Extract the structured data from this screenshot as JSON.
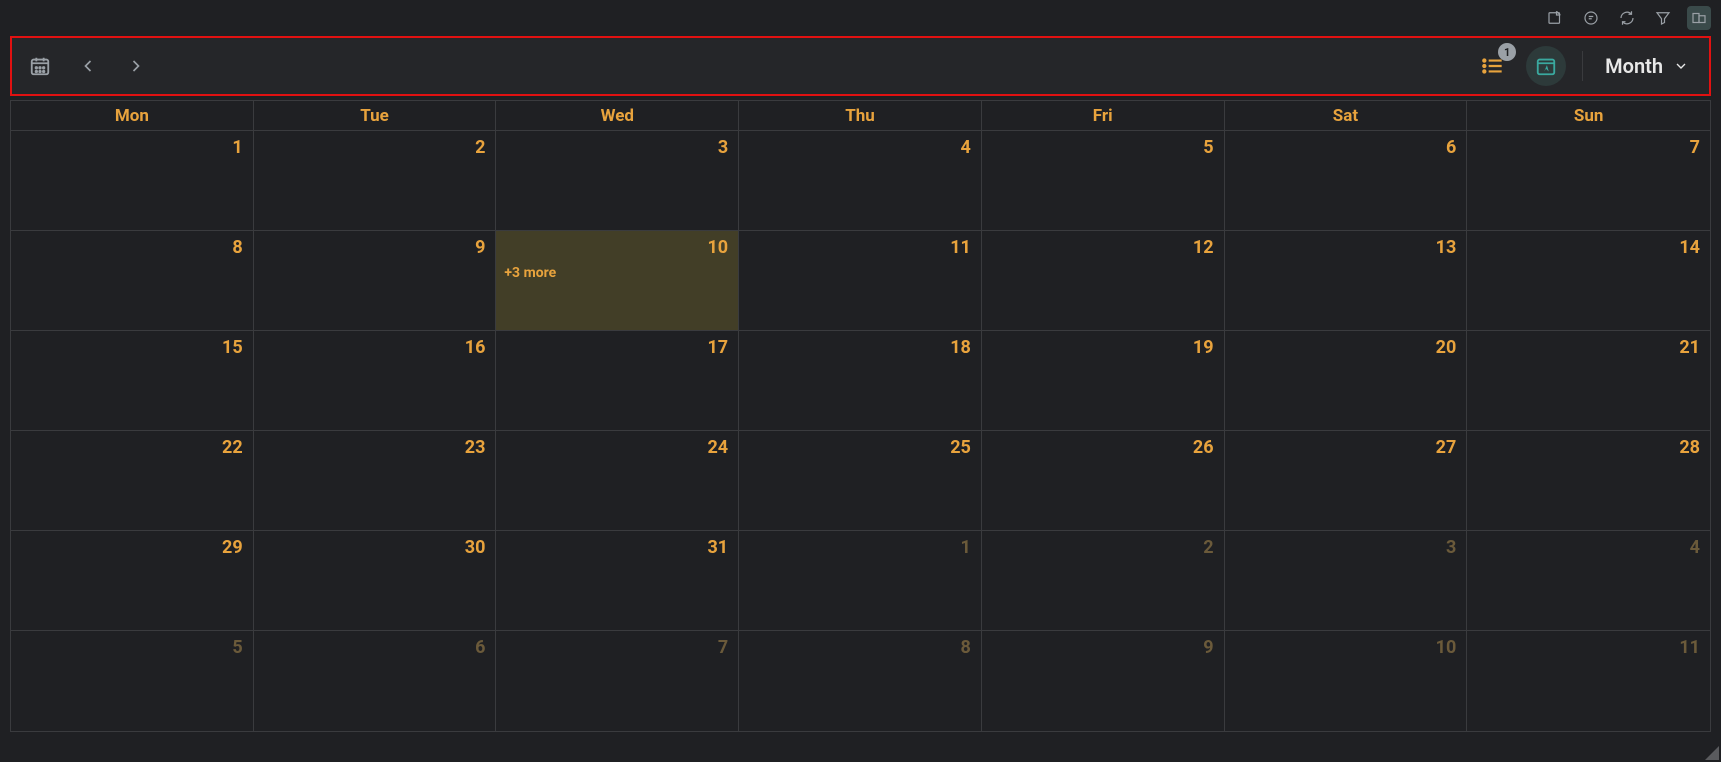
{
  "toolbar": {
    "badge_count": "1",
    "view_label": "Month"
  },
  "calendar": {
    "daynames": [
      "Mon",
      "Tue",
      "Wed",
      "Thu",
      "Fri",
      "Sat",
      "Sun"
    ],
    "weeks": [
      [
        {
          "num": "1"
        },
        {
          "num": "2"
        },
        {
          "num": "3"
        },
        {
          "num": "4"
        },
        {
          "num": "5"
        },
        {
          "num": "6"
        },
        {
          "num": "7"
        }
      ],
      [
        {
          "num": "8"
        },
        {
          "num": "9"
        },
        {
          "num": "10",
          "today": true,
          "more": "+3 more"
        },
        {
          "num": "11"
        },
        {
          "num": "12"
        },
        {
          "num": "13"
        },
        {
          "num": "14"
        }
      ],
      [
        {
          "num": "15"
        },
        {
          "num": "16"
        },
        {
          "num": "17"
        },
        {
          "num": "18"
        },
        {
          "num": "19"
        },
        {
          "num": "20"
        },
        {
          "num": "21"
        }
      ],
      [
        {
          "num": "22"
        },
        {
          "num": "23"
        },
        {
          "num": "24"
        },
        {
          "num": "25"
        },
        {
          "num": "26"
        },
        {
          "num": "27"
        },
        {
          "num": "28"
        }
      ],
      [
        {
          "num": "29"
        },
        {
          "num": "30"
        },
        {
          "num": "31"
        },
        {
          "num": "1",
          "other": true
        },
        {
          "num": "2",
          "other": true
        },
        {
          "num": "3",
          "other": true
        },
        {
          "num": "4",
          "other": true
        }
      ],
      [
        {
          "num": "5",
          "other": true
        },
        {
          "num": "6",
          "other": true
        },
        {
          "num": "7",
          "other": true
        },
        {
          "num": "8",
          "other": true
        },
        {
          "num": "9",
          "other": true
        },
        {
          "num": "10",
          "other": true
        },
        {
          "num": "11",
          "other": true
        }
      ]
    ]
  }
}
